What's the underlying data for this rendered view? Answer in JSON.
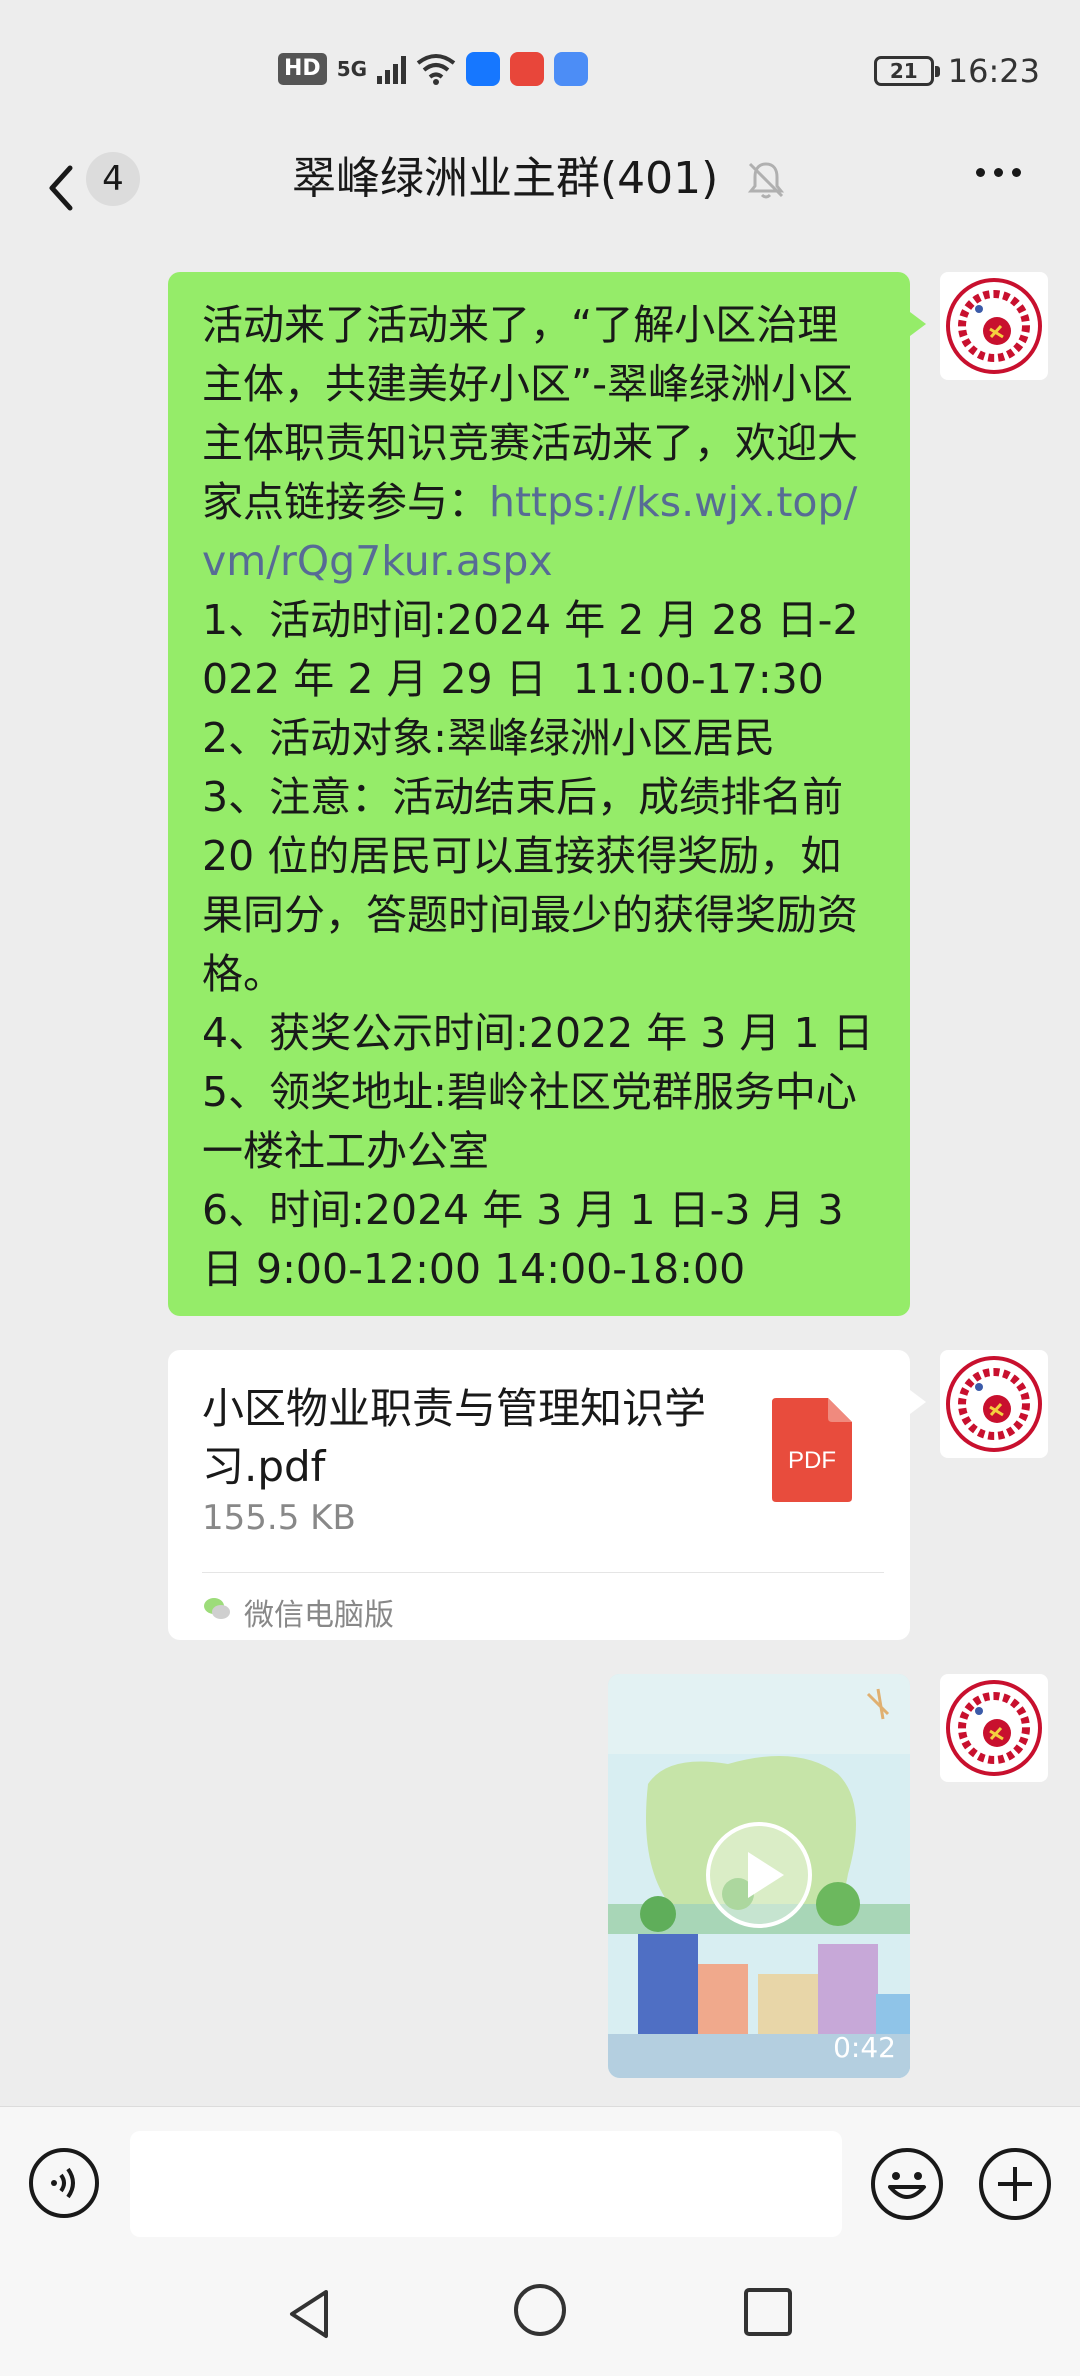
{
  "status_bar": {
    "hd": "HD",
    "network": "5G",
    "battery": "21",
    "time": "16:23"
  },
  "header": {
    "unread_count": "4",
    "title": "翠峰绿洲业主群(401)",
    "icons": [
      "back-icon",
      "mute-bell-icon",
      "more-icon"
    ]
  },
  "messages": {
    "text_message": {
      "intro": "活动来了活动来了，“了解小区治理主体，共建美好小区”-翠峰绿洲小区主体职责知识竞赛活动来了，欢迎大家点链接参与：",
      "link": "https://ks.wjx.top/vm/rQg7kur.aspx",
      "body": "\n1、活动时间:2024 年 2 月 28 日-2022 年 2 月 29 日  11:00-17:30\n2、活动对象:翠峰绿洲小区居民\n3、注意：活动结束后，成绩排名前 20 位的居民可以直接获得奖励，如果同分，答题时间最少的获得奖励资格。\n4、获奖公示时间:2022 年 3 月 1 日\n5、领奖地址:碧岭社区党群服务中心一楼社工办公室\n6、时间:2024 年 3 月 1 日-3 月 3 日 9:00-12:00 14:00-18:00"
    },
    "file_message": {
      "file_name": "小区物业职责与管理知识学习.pdf",
      "file_size": "155.5 KB",
      "file_type": "PDF",
      "source": "微信电脑版"
    },
    "video_message": {
      "duration": "0:42"
    }
  },
  "input_bar": {
    "placeholder": "",
    "icons": [
      "voice-icon",
      "emoji-icon",
      "plus-icon"
    ]
  },
  "nav_bar": {
    "icons": [
      "nav-back-icon",
      "nav-home-icon",
      "nav-recents-icon"
    ]
  },
  "colors": {
    "chat_background": "#ededed",
    "own_bubble": "#95ec69",
    "link": "#576b95",
    "pdf_red": "#e84c3d"
  }
}
